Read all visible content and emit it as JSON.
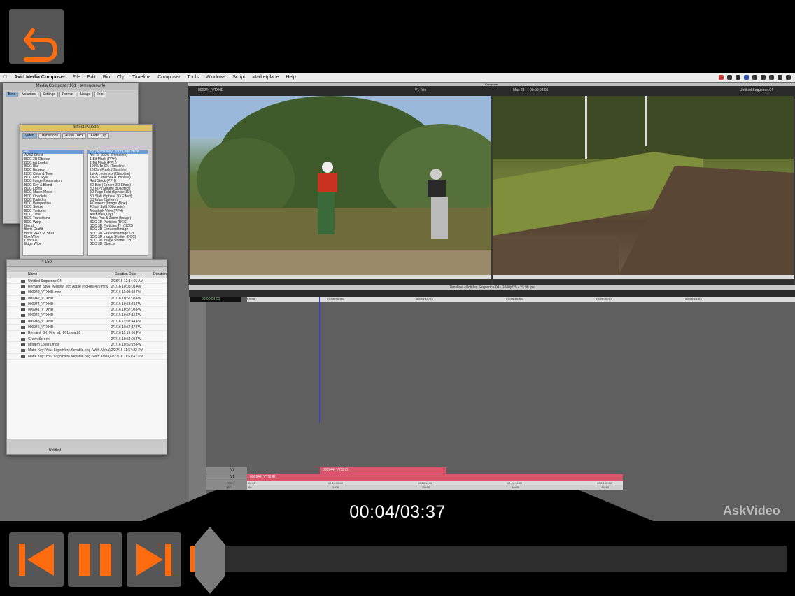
{
  "player": {
    "current_time": "00:04/03:37",
    "progress": 0.018,
    "watermark": "AskVideo",
    "back_icon": "return-arrow-icon",
    "buttons": [
      "skip-back-icon",
      "pause-icon",
      "skip-forward-icon"
    ],
    "accent": "#ff6b0f"
  },
  "menubar": {
    "items": [
      "Avid Media Composer",
      "File",
      "Edit",
      "Bin",
      "Clip",
      "Timeline",
      "Composer",
      "Tools",
      "Windows",
      "Script",
      "Marketplace",
      "Help"
    ]
  },
  "project_window": {
    "title": "Media Composer 101 - terrencuowife",
    "tabs": [
      "Bins",
      "Volumes",
      "Settings",
      "Format",
      "Usage",
      "Info"
    ]
  },
  "effect_palette": {
    "title": "Effect Palette",
    "tabs": [
      "Video",
      "Transitions",
      "Audio Track",
      "Audio Clip"
    ],
    "categories": [
      "All",
      "AVX2 Effect",
      "BCC 3D Objects",
      "BCC Art Looks",
      "BCC Blur",
      "BCC Browser",
      "BCC Color & Tone",
      "BCC Film Style",
      "BCC Image Restoration",
      "BCC Key & Blend",
      "BCC Lights",
      "BCC Match Move",
      "BCC Obsolete",
      "BCC Particles",
      "BCC Perspective",
      "BCC Stylize",
      "BCC Textures",
      "BCC Time",
      "BCC Transitions",
      "BCC Warp",
      "Blend",
      "Boris Graffiti",
      "Boris RED 3d Stuff",
      "Box Wipe",
      "Conceal",
      "Edge Wipe"
    ],
    "effects": [
      "Y2 | Matte Key: Your Logo Here",
      "Arc To 100% (Primeline)",
      "1-Bit Mask (PPH)",
      "1-Bit Mask (PPH)",
      "100% To 0% (Timeline)",
      "10 Dim Flash (Obsolete)",
      "1st-A Letterbox (Obsolete)",
      "1st-B Letterbox (Obsolete)",
      "Red Stock (PPH)",
      "3D Box (Sphere 3D Effect)",
      "3D PIP (Sphere 3D Effect)",
      "3D Page Fold (Sphere 3D)",
      "3D Slab (Sphere 3D Effect)",
      "3D Wipe (Sphere)",
      "4 Corners (Image Wipe)",
      "4 Split Split (Obsolete)",
      "Anaglyph View (PPH)",
      "Animatte (Key)",
      "Artist Pan & Zoom (Image)",
      "BCC 3D Particles (BCC)",
      "BCC 3D Particles TH (BCC)",
      "BCC 3D Extruded Image",
      "BCC 3D Extruded Image TH",
      "BCC 3D Image Shatter (BCC)",
      "BCC 3D Image Shatter TH",
      "BCC 3D Objects"
    ]
  },
  "bin": {
    "title": "* 150",
    "columns": [
      "Name",
      "Creation Date",
      "Duration"
    ],
    "rows": [
      {
        "name": "Untitled Sequence.04",
        "date": "2/26/16 12:14:01 AM"
      },
      {
        "name": "Remaint_Style_Mellow_265 Apple ProRes 422.mov",
        "date": "2/1/16 10:03:01 AM"
      },
      {
        "name": "000942_VTXHD.mov",
        "date": "2/1/16 11:09:58 PM"
      },
      {
        "name": "000942_VTXHD",
        "date": "2/1/16 10:57:08 PM"
      },
      {
        "name": "000944_VTXHD",
        "date": "2/1/16 10:58:41 PM"
      },
      {
        "name": "000941_VTXHD",
        "date": "2/1/16 10:57:03 PM"
      },
      {
        "name": "000946_VTXHD",
        "date": "2/1/16 10:57:15 PM"
      },
      {
        "name": "000943_VTXHD",
        "date": "2/1/16 11:08:44 PM"
      },
      {
        "name": "000945_VTXHD",
        "date": "2/1/16 10:57:17 PM"
      },
      {
        "name": "Remaint_3K_Fire_v1_001.new.01",
        "date": "2/1/16 11:19:06 PM"
      },
      {
        "name": "Green Screen",
        "date": "2/7/16 10:54:05 PM"
      },
      {
        "name": "Modern Lovers.mov",
        "date": "2/7/16 10:50:28 PM"
      },
      {
        "name": "Matte Key: Your Logo Here.Keyable.png (With Alpha)",
        "date": "2/27/16 11:54:22 PM"
      },
      {
        "name": "Matte Key: Your Logo Here.Keyable.png (With Alpha)",
        "date": "2/27/16 11:51:47 PM"
      }
    ],
    "view": "Untitled"
  },
  "composer": {
    "title": "Composer",
    "source_clip": "000944_VTXHD",
    "track": "V1 Trm",
    "timecode": "00:00:04:01",
    "sequence": "Untitled Sequence.04",
    "mas": "Mas 24"
  },
  "timeline": {
    "title": "Timeline - Untitled Sequence.04 - 1080p/25 - 23.98 fps",
    "timecode": "00:00:04:01",
    "ruler": [
      "00:00",
      "00:00:05:00",
      "00:00:10:00",
      "00:00:15:00",
      "00:00:20:00",
      "00:00:25:00"
    ],
    "tracks": [
      {
        "label": "V2",
        "clip": "000944_VTXHD"
      },
      {
        "label": "V1",
        "clip": "000944_VTXHD"
      },
      {
        "label": "TC1",
        "values": [
          "00:00",
          "00:00:05:00",
          "00:00:10:00",
          "00:00:15:00",
          "00:00:20:00"
        ]
      },
      {
        "label": "EC1",
        "values": [
          "00",
          "1+08",
          "25+00",
          "30+00",
          "45+00"
        ]
      }
    ]
  }
}
